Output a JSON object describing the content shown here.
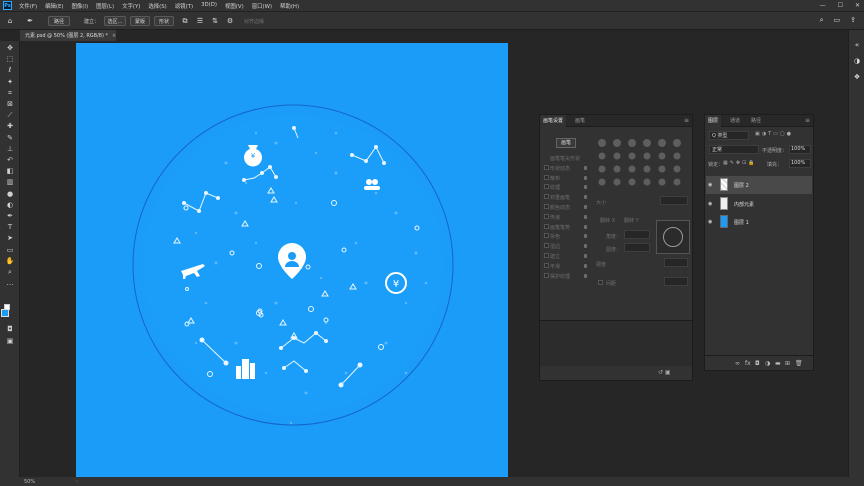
{
  "menubar": {
    "app_logo": "Ps",
    "items": [
      "文件(F)",
      "编辑(E)",
      "图像(I)",
      "图层(L)",
      "文字(Y)",
      "选择(S)",
      "滤镜(T)",
      "3D(D)",
      "视图(V)",
      "窗口(W)",
      "帮助(H)"
    ]
  },
  "options_bar": {
    "mode_label": "路径",
    "build_label": "建立：",
    "selection_btn": "选区...",
    "mask_btn": "蒙版",
    "shape_btn": "形状",
    "align_edges": "对齐边缘"
  },
  "document_tab": {
    "label": "元素.psd @ 50% (图层 2, RGB/8) *",
    "close": "×"
  },
  "toolbar": {
    "icons": [
      "move-icon",
      "marquee-icon",
      "lasso-icon",
      "magic-wand-icon",
      "crop-icon",
      "frame-icon",
      "eyedropper-icon",
      "healing-icon",
      "brush-icon",
      "stamp-icon",
      "history-brush-icon",
      "eraser-icon",
      "gradient-icon",
      "blur-icon",
      "dodge-icon",
      "pen-icon",
      "type-icon",
      "path-select-icon",
      "shape-icon",
      "hand-icon",
      "zoom-icon",
      "more-icon"
    ],
    "foreground_color": "#1b9cf9",
    "background_color": "#ffffff"
  },
  "brush_panel": {
    "tabs": [
      "画笔设置",
      "画笔"
    ],
    "brush_button": "画笔",
    "options": [
      "画笔笔尖形状",
      "形状动态",
      "散布",
      "纹理",
      "双重画笔",
      "颜色动态",
      "传递",
      "画笔笔势",
      "杂色",
      "湿边",
      "建立",
      "平滑",
      "保护纹理"
    ],
    "size_label": "大小",
    "flip_x": "翻转 X",
    "flip_y": "翻转 Y",
    "angle_label": "角度：",
    "roundness_label": "圆度：",
    "hardness_label": "硬度",
    "spacing_label": "间距"
  },
  "layers_panel": {
    "tabs": [
      "图层",
      "通道",
      "路径"
    ],
    "search_kind": "Q 类型",
    "blend_mode": "正常",
    "opacity_label": "不透明度：",
    "opacity_value": "100%",
    "lock_label": "锁定：",
    "fill_label": "填充：",
    "fill_value": "100%",
    "layers": [
      {
        "name": "图层 2",
        "selected": true,
        "thumb": "transparent"
      },
      {
        "name": "内部元素",
        "selected": false,
        "thumb": "group"
      },
      {
        "name": "图层 1",
        "selected": false,
        "thumb": "blue"
      }
    ],
    "bottom_icons": [
      "link-icon",
      "fx-icon",
      "mask-icon",
      "adjustment-icon",
      "folder-icon",
      "new-layer-icon",
      "trash-icon"
    ]
  },
  "statusbar": {
    "zoom": "50%"
  },
  "colors": {
    "canvas_blue": "#1b9cf9",
    "ps_blue": "#31a8ff"
  }
}
